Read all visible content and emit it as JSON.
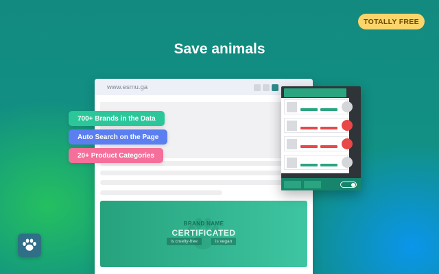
{
  "badge": {
    "label": "TOTALLY FREE"
  },
  "headline": "Save animals",
  "browser": {
    "url": "www.esmu.ga",
    "certificate": {
      "brand_name": "BRAND NAME",
      "title": "CERTIFICATED",
      "tags": [
        "is cruelty-free",
        "is vegan"
      ]
    }
  },
  "features": [
    {
      "label": "700+ Brands in the Data",
      "color": "#2bc79a"
    },
    {
      "label": "Auto Search on the Page",
      "color": "#5b7ff0"
    },
    {
      "label": "20+ Product Categories",
      "color": "#f4709a"
    }
  ],
  "popup": {
    "rows": [
      {
        "status": "green"
      },
      {
        "status": "red"
      },
      {
        "status": "red"
      },
      {
        "status": "green"
      }
    ],
    "toggle_on": true
  },
  "colors": {
    "accent_green": "#2aa57f",
    "accent_red": "#e84848",
    "badge_yellow": "#fbd56a"
  },
  "icons": {
    "app_icon": "paw-icon"
  }
}
